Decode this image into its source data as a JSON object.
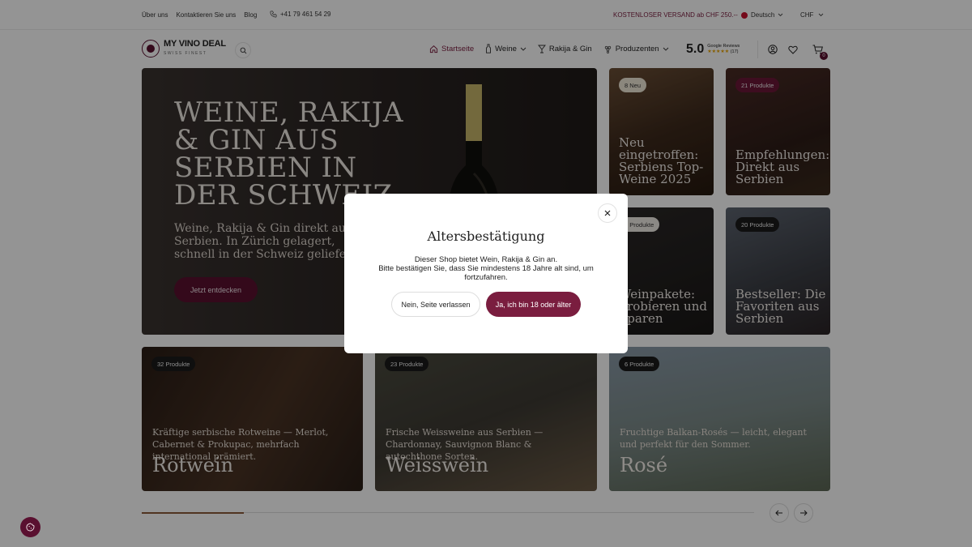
{
  "topbar": {
    "links": [
      "Über uns",
      "Kontaktieren Sie uns",
      "Blog"
    ],
    "phone": "+41 79 461 54 29",
    "shipping": "KOSTENLOSER VERSAND ab CHF 250.--",
    "language": "Deutsch",
    "currency": "CHF"
  },
  "header": {
    "logo_title": "MY VINO DEAL",
    "logo_sub": "SWISS FINEST",
    "nav": [
      {
        "label": "Startseite",
        "icon": "home-icon"
      },
      {
        "label": "Weine",
        "icon": "wine-bottle-icon"
      },
      {
        "label": "Rakija & Gin",
        "icon": "glass-icon"
      },
      {
        "label": "Produzenten",
        "icon": "grapes-icon"
      }
    ],
    "rating_score": "5.0",
    "rating_label": "Google Reviews",
    "rating_stars": "★★★★★",
    "rating_count": "(17)",
    "cart_count": "0"
  },
  "hero": {
    "title": "WEINE, RAKIJA & GIN AUS SERBIEN IN DER SCHWEIZ",
    "subtitle": "Weine, Rakija & Gin direkt aus Serbien. In Zürich gelagert, schnell in der Schweiz geliefert.",
    "cta": "Jetzt entdecken"
  },
  "cards": [
    {
      "badge": "8 Neu",
      "title": "Neu eingetroffen: Serbiens Top-Weine 2025"
    },
    {
      "badge": "21 Produkte",
      "title": "Empfehlungen: Direkt aus Serbien"
    },
    {
      "badge": "4 Produkte",
      "title": "Weinpakete: Probieren und Sparen"
    },
    {
      "badge": "20 Produkte",
      "title": "Bestseller: Die Favoriten aus Serbien"
    },
    {
      "badge": "32 Produkte",
      "desc": "Kräftige serbische Rotweine — Merlot, Cabernet & Prokupac, mehrfach international prämiert.",
      "title": "Rotwein"
    },
    {
      "badge": "23 Produkte",
      "desc": "Frische Weissweine aus Serbien — Chardonnay, Sauvignon Blanc & autochthone Sorten.",
      "title": "Weisswein"
    },
    {
      "badge": "6 Produkte",
      "desc": "Fruchtige Balkan-Rosés — leicht, elegant und perfekt für den Sommer.",
      "title": "Rosé"
    }
  ],
  "modal": {
    "title": "Altersbestätigung",
    "line1": "Dieser Shop bietet Wein, Rakija & Gin an.",
    "line2": "Bitte bestätigen Sie, dass Sie mindestens 18 Jahre alt sind, um fortzufahren.",
    "no_button": "Nein, Seite verlassen",
    "yes_button": "Ja, ich bin 18 oder älter"
  },
  "carousel": {
    "progress": 0.167
  }
}
